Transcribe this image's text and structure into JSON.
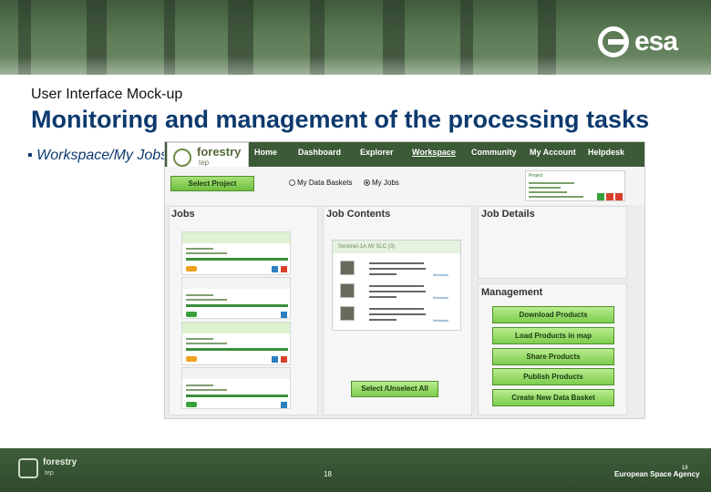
{
  "slide": {
    "subtitle": "User Interface Mock-up",
    "title": "Monitoring and management of the processing tasks",
    "bullet": "Workspace/My Jobs",
    "bullet_marker": "▪",
    "logo_text": "esa"
  },
  "app": {
    "brand": {
      "name": "forestry",
      "sub": "tep"
    },
    "nav": [
      "Home",
      "Dashboard",
      "Explorer",
      "Workspace",
      "Community",
      "My Account",
      "Helpdesk"
    ],
    "active_nav": "Workspace",
    "toolbar": {
      "select_project": "Select Project",
      "radio_baskets": "My Data Baskets",
      "radio_jobs": "My Jobs",
      "project_label": "Project"
    },
    "panels": {
      "jobs": "Jobs",
      "job_contents": "Job Contents",
      "job_details": "Job Details",
      "management": "Management"
    },
    "job_contents_header": "Sentinel-1A IW SLC (3)",
    "metadata_label": "Metadata",
    "select_all": "Select /Unselect All",
    "management_buttons": [
      "Download Products",
      "Load Products in map",
      "Share Products",
      "Publish Products",
      "Create New Data Basket"
    ]
  },
  "footer": {
    "brand": "forestry",
    "brand_sub": "tep",
    "page_number": "18",
    "page_number_corner": "18",
    "agency": "European Space Agency"
  },
  "colors": {
    "title_blue": "#0d3a6e",
    "nav_green": "#3b5a36",
    "button_green": "#7dcd4e",
    "footer_green": "#2f4a2c"
  }
}
